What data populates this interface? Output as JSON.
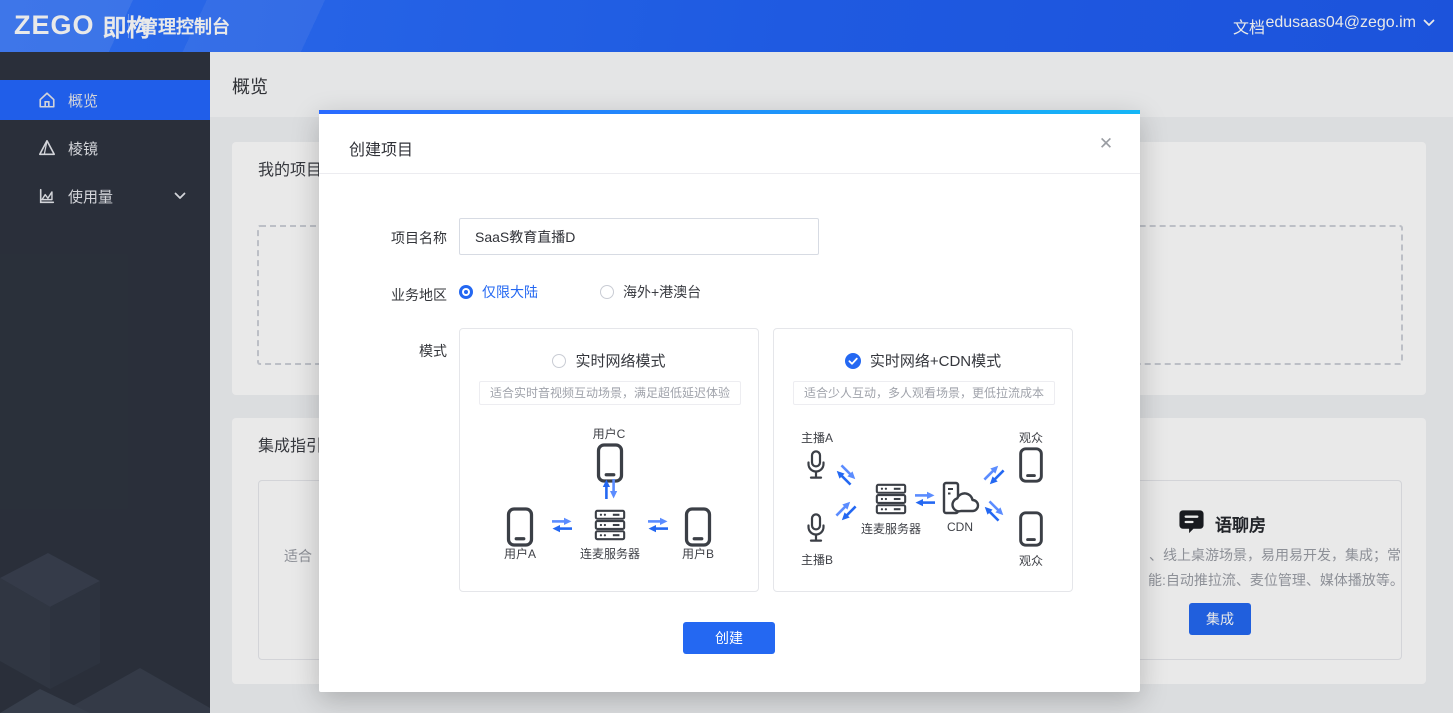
{
  "colors": {
    "accent_blue": "#2468f2",
    "topbar_blue": "#2263f7",
    "accent_gradient_end": "#15b6f6",
    "sidebar_bg": "#2e3440"
  },
  "topbar": {
    "logo_en": "ZEGO",
    "logo_cn": "即构",
    "title": "管理控制台",
    "docs_label": "文档",
    "account": "edusaas04@zego.im"
  },
  "sidebar": {
    "items": [
      {
        "label": "概览",
        "selected": true
      },
      {
        "label": "棱镜",
        "selected": false
      },
      {
        "label": "使用量",
        "selected": false,
        "expandable": true
      }
    ]
  },
  "page": {
    "title": "概览",
    "my_projects_title": "我的项目",
    "integration_title": "集成指引",
    "left_fragment": "适合",
    "scene_card": {
      "title": "语聊房",
      "desc_line1": "、线上桌游场景，易用易开发，集成；常",
      "desc_line2": "能:自动推拉流、麦位管理、媒体播放等。",
      "button": "集成"
    }
  },
  "modal": {
    "title": "创建项目",
    "close": "✕",
    "fields": {
      "name_label": "项目名称",
      "name_value": "SaaS教育直播D",
      "region_label": "业务地区",
      "region_options": [
        {
          "label": "仅限大陆",
          "selected": true
        },
        {
          "label": "海外+港澳台",
          "selected": false
        }
      ],
      "mode_label": "模式"
    },
    "modes": [
      {
        "title": "实时网络模式",
        "selected": false,
        "subtitle": "适合实时音视频互动场景，满足超低延迟体验",
        "diagram": {
          "top_label": "用户C",
          "left_label": "用户A",
          "server_label": "连麦服务器",
          "right_label": "用户B"
        }
      },
      {
        "title": "实时网络+CDN模式",
        "selected": true,
        "subtitle": "适合少人互动，多人观看场景，更低拉流成本",
        "diagram": {
          "anchor_a": "主播A",
          "anchor_b": "主播B",
          "server_label": "连麦服务器",
          "cdn_label": "CDN",
          "viewer_top": "观众",
          "viewer_bottom": "观众"
        }
      }
    ],
    "submit": "创建"
  }
}
